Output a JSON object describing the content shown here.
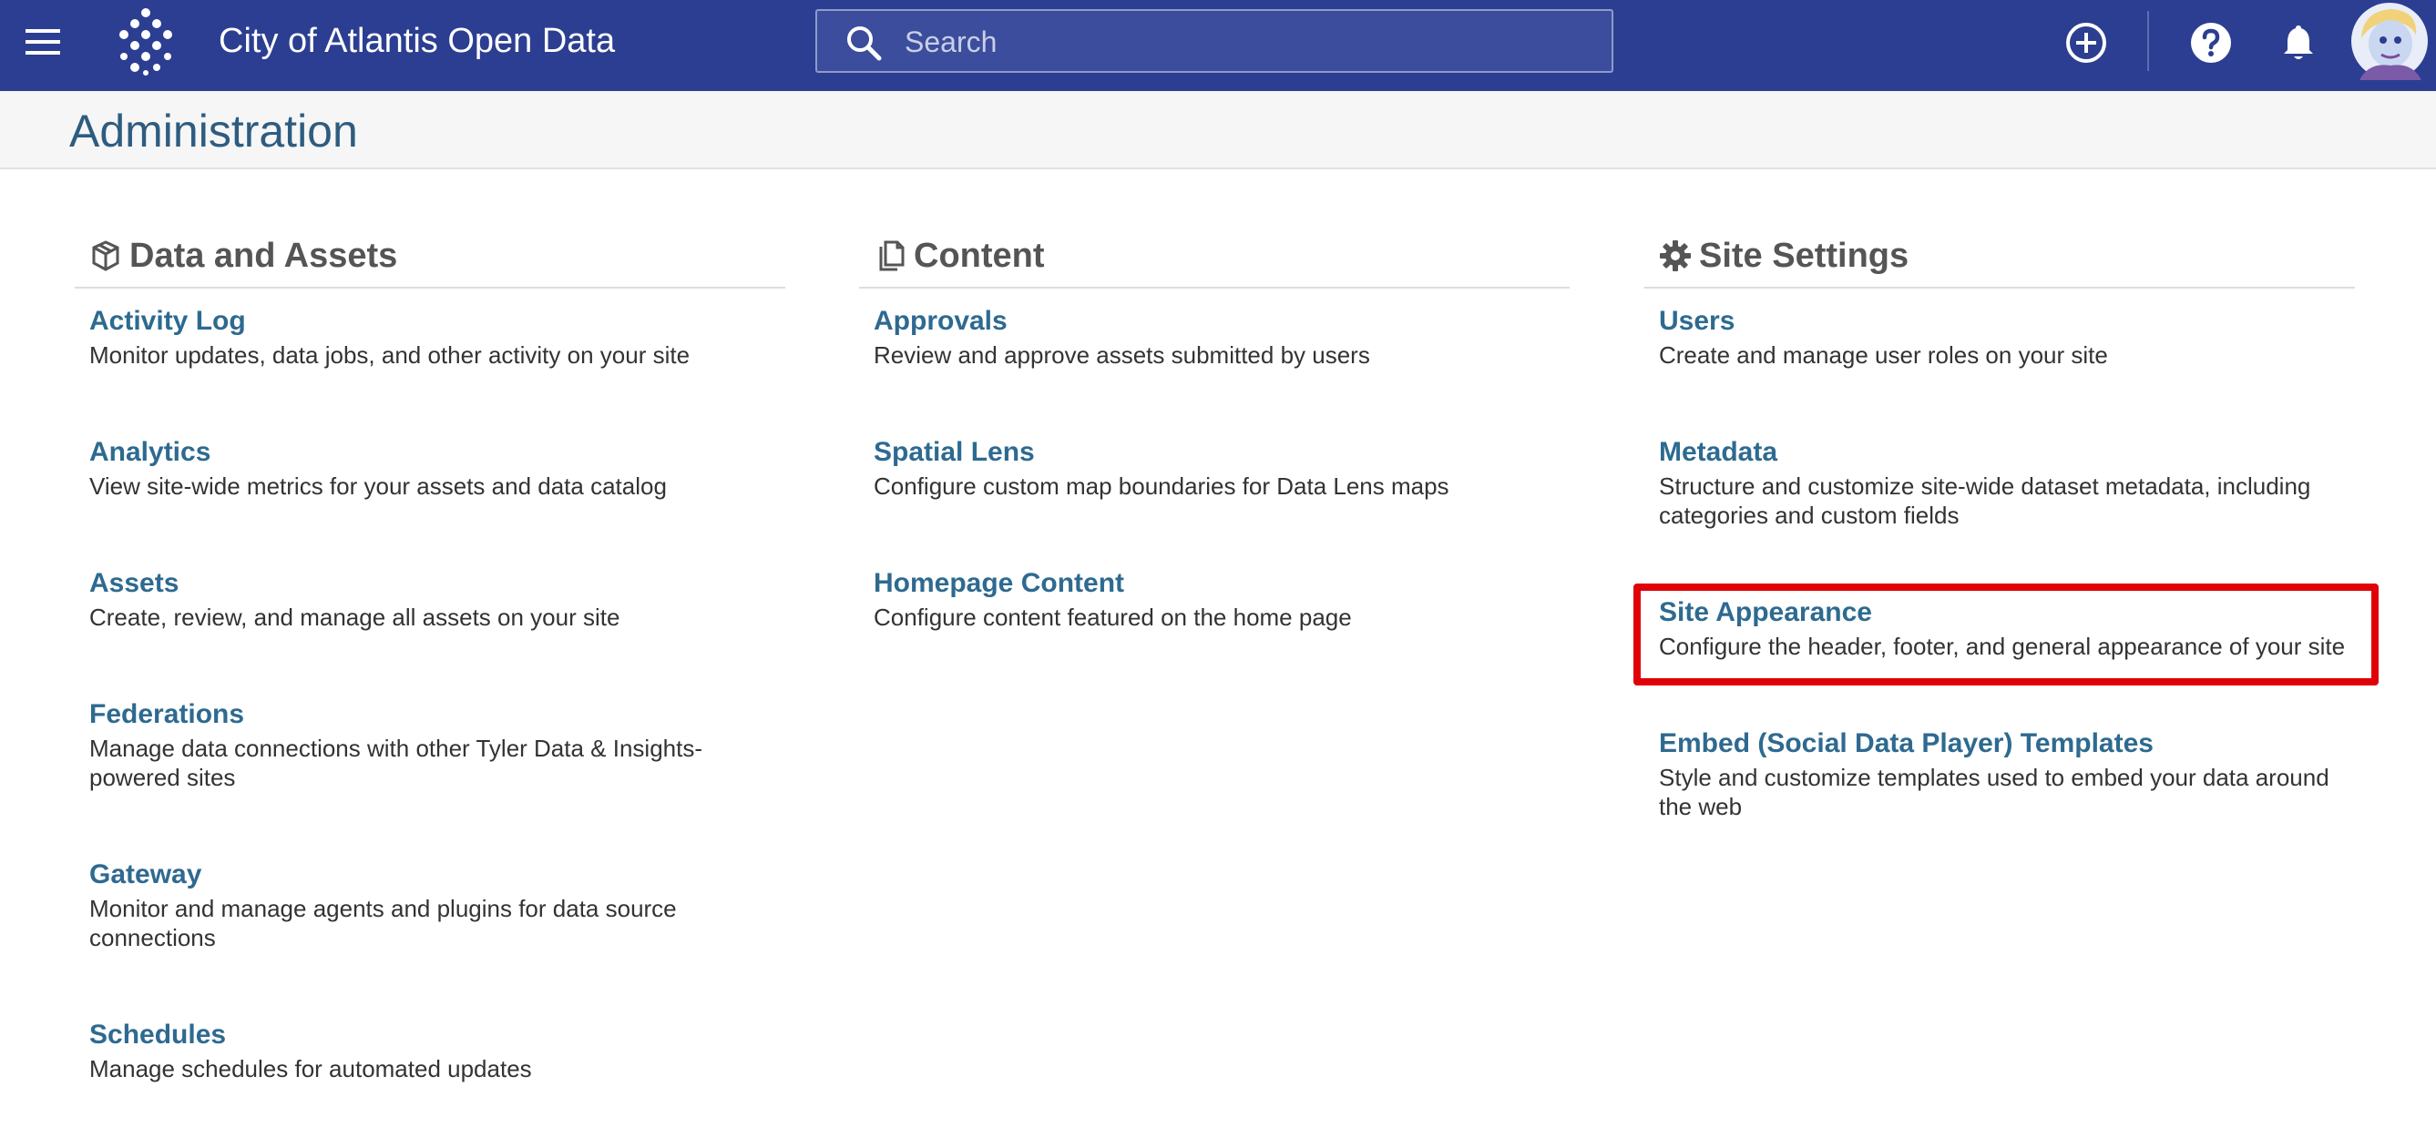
{
  "topbar": {
    "title": "City of Atlantis Open Data",
    "search_placeholder": "Search",
    "icons": {
      "menu": "hamburger-menu-icon",
      "logo": "dots-diamond-logo",
      "search": "search-icon",
      "create": "plus-circle-icon",
      "help": "help-circle-icon",
      "notifications": "bell-icon",
      "avatar": "user-avatar"
    },
    "colors": {
      "background": "#2c3e91",
      "search_background": "#3b4d9c"
    }
  },
  "page": {
    "title": "Administration"
  },
  "sections": [
    {
      "title": "Data and Assets",
      "icon": "cube-icon",
      "items": [
        {
          "title": "Activity Log",
          "description": "Monitor updates, data jobs, and other activity on your site"
        },
        {
          "title": "Analytics",
          "description": "View site-wide metrics for your assets and data catalog"
        },
        {
          "title": "Assets",
          "description": "Create, review, and manage all assets on your site"
        },
        {
          "title": "Federations",
          "description_line1": "Manage data connections with other Tyler Data & Insights-",
          "description_line2": "powered sites"
        },
        {
          "title": "Gateway",
          "description_line1": "Monitor and manage agents and plugins for data source",
          "description_line2": "connections"
        },
        {
          "title": "Schedules",
          "description": "Manage schedules for automated updates"
        }
      ]
    },
    {
      "title": "Content",
      "icon": "copy-pages-icon",
      "items": [
        {
          "title": "Approvals",
          "description": "Review and approve assets submitted by users"
        },
        {
          "title": "Spatial Lens",
          "description": "Configure custom map boundaries for Data Lens maps"
        },
        {
          "title": "Homepage Content",
          "description": "Configure content featured on the home page"
        }
      ]
    },
    {
      "title": "Site Settings",
      "icon": "gear-icon",
      "items": [
        {
          "title": "Users",
          "description": "Create and manage user roles on your site"
        },
        {
          "title": "Metadata",
          "description_line1": "Structure and customize site-wide dataset metadata, including",
          "description_line2": "categories and custom fields"
        },
        {
          "title": "Site Appearance",
          "description": "Configure the header, footer, and general appearance of your site",
          "highlighted": true
        },
        {
          "title": "Embed (Social Data Player) Templates",
          "description_line1": "Style and customize templates used to embed your data around",
          "description_line2": "the web"
        }
      ]
    }
  ],
  "colors": {
    "link": "#2e6a90",
    "page_title": "#2e5c80",
    "highlight_border": "#e00008"
  }
}
